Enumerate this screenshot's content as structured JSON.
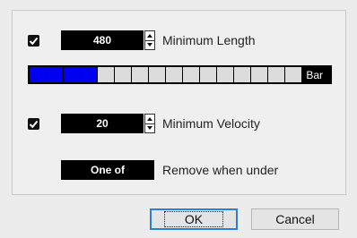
{
  "min_length": {
    "checked": true,
    "value": "480",
    "label": "Minimum Length",
    "bar_unit": "Bar",
    "filled_cells": 4,
    "total_cells": 16,
    "fill_color": "#0000f0"
  },
  "min_velocity": {
    "checked": true,
    "value": "20",
    "label": "Minimum Velocity"
  },
  "remove_when": {
    "selected": "One of",
    "label": "Remove when under"
  },
  "buttons": {
    "ok": "OK",
    "cancel": "Cancel"
  },
  "icons": {
    "checkbox": "checkmark-icon",
    "spinner_up": "arrow-up-icon",
    "spinner_down": "arrow-down-icon"
  }
}
